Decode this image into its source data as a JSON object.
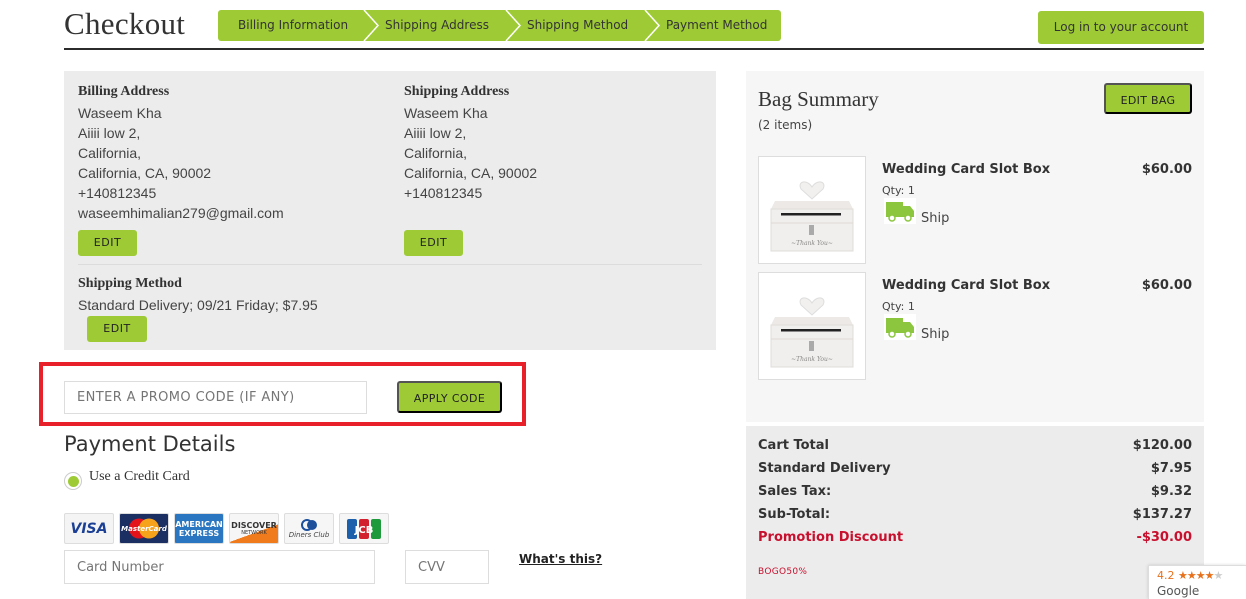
{
  "header": {
    "title": "Checkout",
    "steps": [
      "Billing Information",
      "Shipping Address",
      "Shipping Method",
      "Payment Method"
    ],
    "login_label": "Log in to your account"
  },
  "billing": {
    "title": "Billing Address",
    "lines": [
      "Waseem Kha",
      "Aiiii low 2,",
      "California,",
      "California, CA, 90002",
      "+140812345",
      "waseemhimalian279@gmail.com"
    ],
    "edit_label": "EDIT"
  },
  "shipping": {
    "title": "Shipping Address",
    "lines": [
      "Waseem Kha",
      "Aiiii low 2,",
      "California,",
      "California, CA, 90002",
      "+140812345"
    ],
    "edit_label": "EDIT"
  },
  "shipping_method": {
    "title": "Shipping Method",
    "value": "Standard Delivery; 09/21 Friday; $7.95",
    "edit_label": "EDIT"
  },
  "promo": {
    "placeholder": "ENTER A PROMO CODE (IF ANY)",
    "value": "",
    "apply_label": "APPLY CODE"
  },
  "payment": {
    "title": "Payment Details",
    "option_label": "Use a Credit Card",
    "option_selected": true,
    "cards": [
      "VISA",
      "MasterCard",
      "American Express",
      "Discover Network",
      "Diners Club",
      "JCB"
    ],
    "card_number_placeholder": "Card Number",
    "cvv_placeholder": "CVV",
    "whats_this": "What's this?"
  },
  "bag": {
    "title": "Bag Summary",
    "count": "(2 items)",
    "edit_label": "EDIT BAG",
    "items": [
      {
        "name": "Wedding Card Slot Box",
        "qty": "Qty: 1",
        "price": "$60.00",
        "ship": "Ship",
        "image": "wedding-card-box-image"
      },
      {
        "name": "Wedding Card Slot Box",
        "qty": "Qty: 1",
        "price": "$60.00",
        "ship": "Ship",
        "image": "wedding-card-box-image"
      }
    ]
  },
  "totals": {
    "rows": [
      {
        "label": "Cart Total",
        "value": "$120.00"
      },
      {
        "label": "Standard Delivery",
        "value": "$7.95"
      },
      {
        "label": "Sales Tax:",
        "value": "$9.32"
      },
      {
        "label": "Sub-Total:",
        "value": "$137.27"
      }
    ],
    "discount": {
      "label": "Promotion Discount",
      "value": "-$30.00"
    },
    "applied_code": "BOGO50%"
  },
  "google_badge": {
    "rating": "4.2",
    "stars_filled": "★★★★",
    "stars_empty": "★",
    "name": "Google"
  },
  "colors": {
    "accent": "#9ecb35",
    "highlight_frame": "#e8202a",
    "discount": "#c8102e"
  }
}
